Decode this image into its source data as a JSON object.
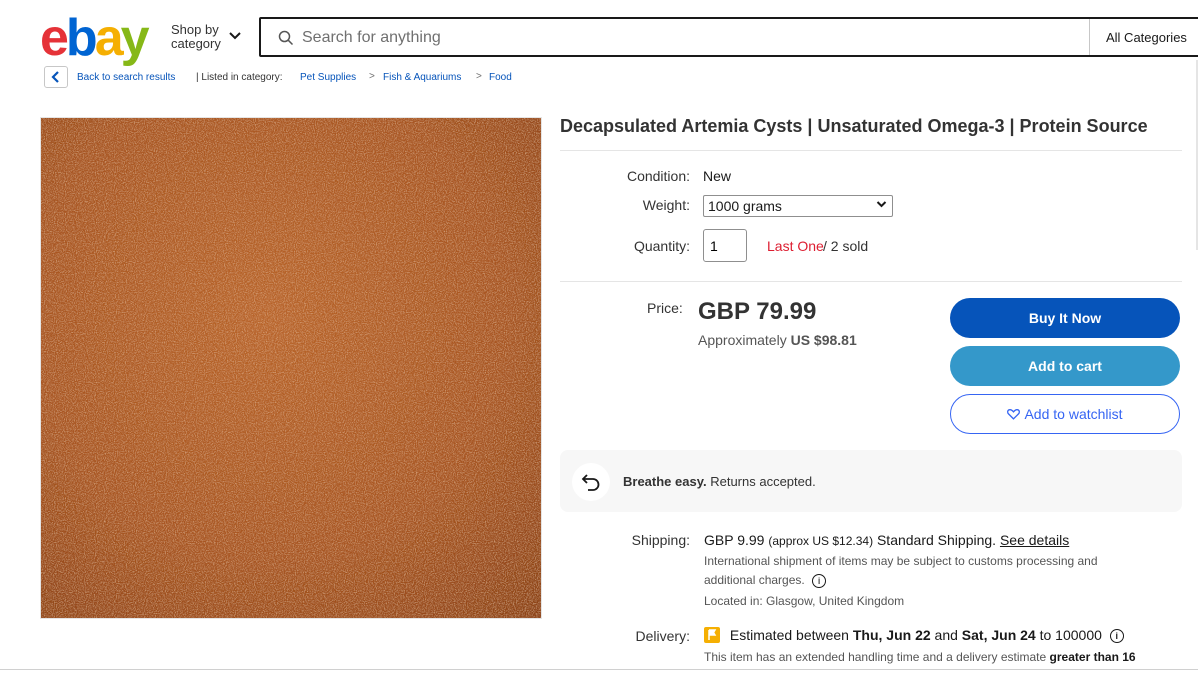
{
  "header": {
    "logo": [
      "e",
      "b",
      "a",
      "y"
    ],
    "logo_colors": [
      "#e53238",
      "#0064d2",
      "#f5af02",
      "#86b817"
    ],
    "shop_by_line1": "Shop by",
    "shop_by_line2": "category",
    "search_placeholder": "Search for anything",
    "category_select": "All Categories"
  },
  "breadcrumb": {
    "back": "Back to search results",
    "listed_in": "| Listed in category:",
    "items": [
      "Pet Supplies",
      "Fish & Aquariums",
      "Food"
    ],
    "separator": ">"
  },
  "product": {
    "image_alt": "Decapsulated Artemia Cysts",
    "title": "Decapsulated Artemia Cysts | Unsaturated Omega-3 | Protein Source",
    "condition_label": "Condition:",
    "condition_value": "New",
    "weight_label": "Weight:",
    "weight_value": "1000 grams",
    "quantity_label": "Quantity:",
    "quantity_value": "1",
    "last_one": "Last One",
    "sold": "/ 2 sold",
    "price_label": "Price:",
    "price": "GBP 79.99",
    "approx_prefix": "Approximately",
    "approx_value": "US $98.81"
  },
  "actions": {
    "buy_now": "Buy It Now",
    "add_to_cart": "Add to cart",
    "watchlist": "Add to watchlist"
  },
  "returns": {
    "bold": "Breathe easy.",
    "text": "Returns accepted."
  },
  "shipping": {
    "label": "Shipping:",
    "amount": "GBP 9.99",
    "approx": "(approx US $12.34)",
    "service": "Standard Shipping.",
    "see_details": "See details",
    "note_line1": "International shipment of items may be subject to customs processing and",
    "note_line2": "additional charges.",
    "located": "Located in: Glasgow, United Kingdom"
  },
  "delivery": {
    "label": "Delivery:",
    "estimated": "Estimated between",
    "date_from": "Thu, Jun 22",
    "and": "and",
    "date_to": "Sat, Jun 24",
    "to": "to 100000",
    "note": "This item has an extended handling time and a delivery estimate",
    "note_bold": "greater than 16"
  },
  "colors": {
    "buy_now": "#0654ba",
    "add_to_cart": "#3498ca",
    "watchlist_border": "#3665f3",
    "last_one": "#dd1e31"
  }
}
